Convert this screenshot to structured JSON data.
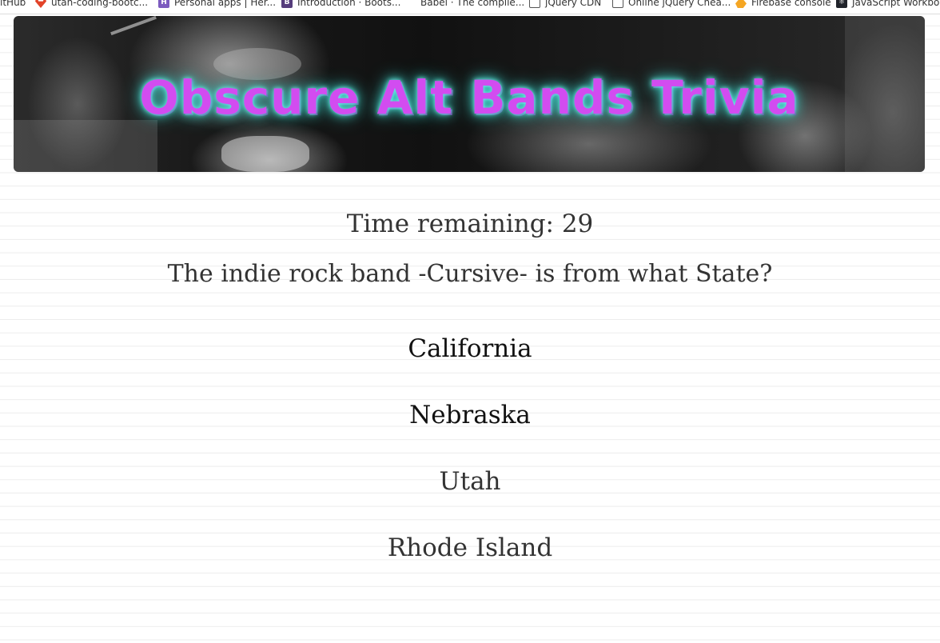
{
  "bookmarks": [
    {
      "label": "itHub",
      "icon": "github-icon"
    },
    {
      "label": "utah-coding-bootc...",
      "icon": "gitlab-icon"
    },
    {
      "label": "Personal apps | Her...",
      "icon": "heroku-icon"
    },
    {
      "label": "Introduction · Boots...",
      "icon": "bootstrap-icon"
    },
    {
      "label": "Babel · The compile...",
      "icon": "babel-icon"
    },
    {
      "label": "jQuery CDN",
      "icon": "page-icon"
    },
    {
      "label": "Online jQuery Chea...",
      "icon": "page-icon"
    },
    {
      "label": "Firebase console",
      "icon": "firebase-icon"
    },
    {
      "label": "JavaScript Workboo",
      "icon": "react-icon"
    }
  ],
  "banner": {
    "title": "Obscure Alt Bands Trivia"
  },
  "timer": {
    "label": "Time remaining: 29"
  },
  "question": {
    "text": "The indie rock band -Cursive- is from what State?"
  },
  "answers": [
    "California",
    "Nebraska",
    "Utah",
    "Rhode Island"
  ],
  "colors": {
    "title": "#d24cf0",
    "title_glow": "#3fd8cf",
    "text": "#333333"
  }
}
